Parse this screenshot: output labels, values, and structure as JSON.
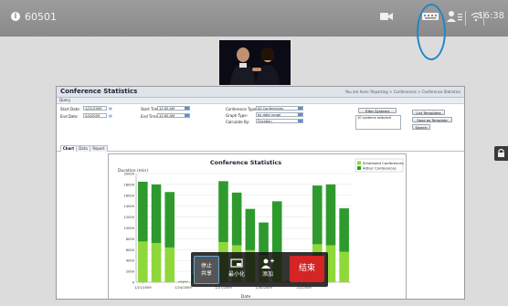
{
  "system": {
    "id": "60501",
    "time": "16:38"
  },
  "report": {
    "title": "Conference Statistics",
    "breadcrumb": "You are here: Reporting > Conferences > Conference Statistics",
    "query_label": "Query",
    "start_date_label": "Start Date:",
    "start_date_value": "1/21/2009",
    "end_date_label": "End Date:",
    "end_date_value": "2/4/2009",
    "start_time_label": "Start Time:",
    "start_time_value": "12:00 AM",
    "end_time_label": "End Time:",
    "end_time_value": "12:00 AM",
    "conf_type_label": "Conference Type:",
    "conf_type_value": "All Conferences",
    "graph_type_label": "Graph Type:",
    "graph_type_value": "by date range",
    "calc_by_label": "Calculate By:",
    "calc_by_value": "Duration",
    "filter_button": "Filter Systems",
    "systems_selected": "10 systems selected",
    "list_templates_button": "List Templates",
    "save_template_button": "Save as Template",
    "search_button": "Search",
    "tabs": [
      "Chart",
      "Data",
      "Report"
    ]
  },
  "call_controls": {
    "stop_share": [
      "停止",
      "共享"
    ],
    "minimize": "最小化",
    "add": "添加",
    "end": "结束"
  },
  "chart_data": {
    "type": "bar",
    "title": "Conference Statistics",
    "ylabel": "Duration (min)",
    "xlabel": "Date",
    "ylim": [
      0,
      20000
    ],
    "yticks": [
      0,
      2000,
      4000,
      6000,
      8000,
      10000,
      12000,
      14000,
      16000,
      18000,
      20000
    ],
    "xtick_labels": [
      "1/21/2009",
      "1/24/2009",
      "1/27/2009",
      "1/30/2009",
      "2/2/2009"
    ],
    "xtick_index": [
      0,
      3,
      6,
      9,
      12
    ],
    "legend": [
      "Scheduled Conferences",
      "Adhoc Conferences"
    ],
    "legend_position": "top-right",
    "colors": {
      "scheduled": "#8ed83a",
      "adhoc": "#2e9a2e"
    },
    "series": [
      {
        "name": "Scheduled Conferences",
        "values": [
          7500,
          7200,
          6400,
          100,
          900,
          100,
          7400,
          6800,
          5900,
          5000,
          5400,
          100,
          100,
          7000,
          6800,
          5600
        ]
      },
      {
        "name": "Adhoc Conferences",
        "values": [
          11000,
          10800,
          10200,
          100,
          400,
          100,
          11200,
          9700,
          7600,
          6000,
          9500,
          100,
          100,
          10800,
          11200,
          8000
        ]
      }
    ]
  }
}
